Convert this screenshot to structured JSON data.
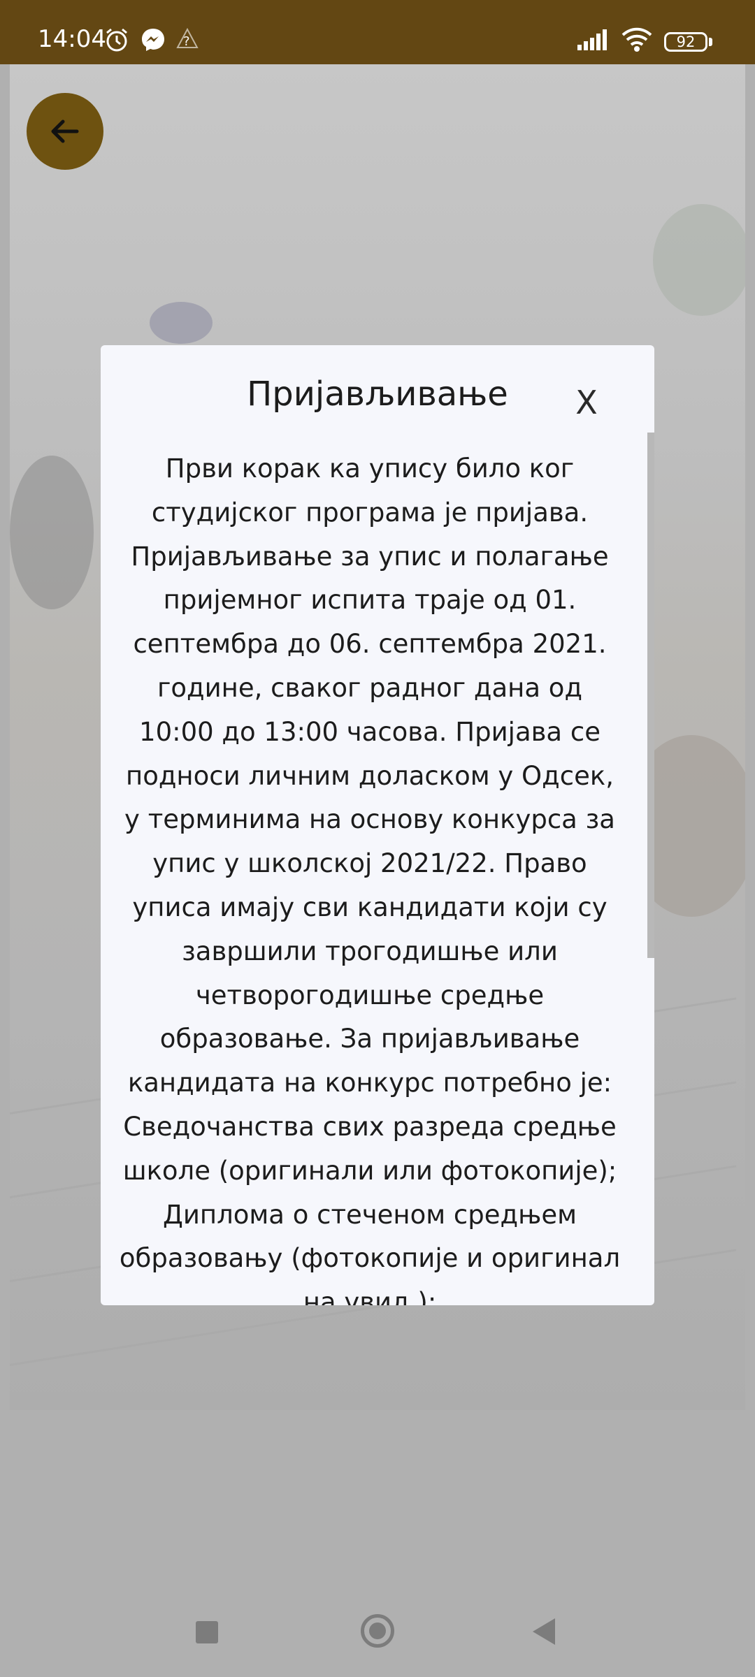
{
  "status_bar": {
    "time": "14:04",
    "battery": "92",
    "icons": [
      "alarm-icon",
      "messenger-icon",
      "unknown-network-icon",
      "signal-icon",
      "wifi-icon",
      "battery-icon"
    ]
  },
  "colors": {
    "status_bar": "#634713",
    "back_button": "#6e5210",
    "dialog_background": "#f6f7fc",
    "overlay": "#9a9a9a"
  },
  "dialog": {
    "title": "Пријављивање",
    "close_label": "X",
    "body": "Први корак ка упису било ког студијског програма је пријава. Пријављивање за упис и полагање пријемног испита траје од  01. септембра до 06. септембра 2021. године, сваког радног дана од 10:00 до 13:00 часова. Пријава се подноси личним доласком у Одсек, у терминима на основу конкурса за упис у школској 2021/22. Право уписа имају сви кандидати који су завршили трогодишње или четворогодишње средње образовање. За пријављивање кандидата на конкурс потребно је: Сведочанства свих разреда средње школе (оригинали или фотокопије); Диплома о стеченом средњем образовању (фотокопије и оригинал на увид );"
  },
  "navigation": {
    "back_icon": "arrow-left-icon",
    "system_buttons": [
      "recents-button",
      "home-button",
      "back-button"
    ]
  }
}
